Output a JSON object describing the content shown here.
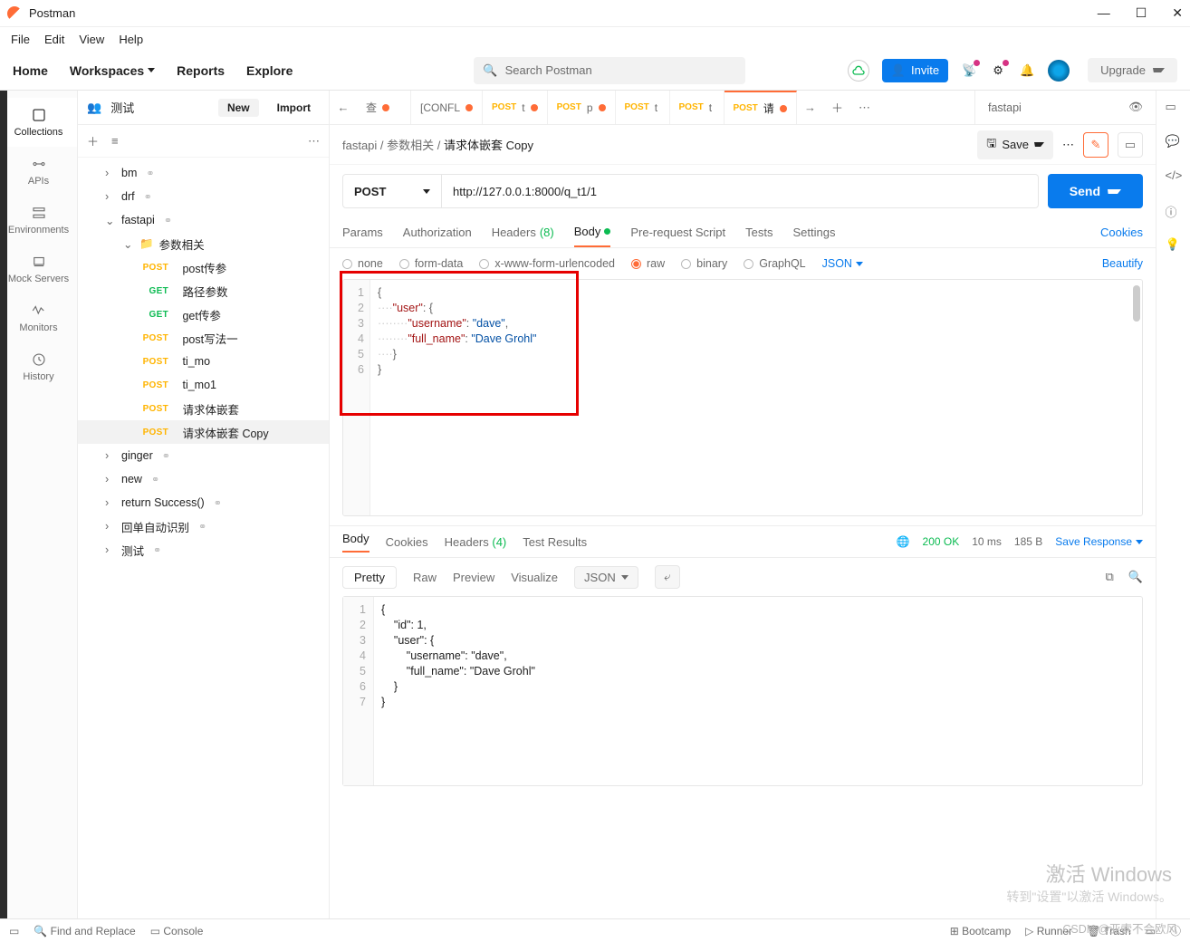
{
  "app": {
    "title": "Postman"
  },
  "menu": [
    "File",
    "Edit",
    "View",
    "Help"
  ],
  "header": {
    "nav": {
      "home": "Home",
      "workspaces": "Workspaces",
      "reports": "Reports",
      "explore": "Explore"
    },
    "search_placeholder": "Search Postman",
    "invite": "Invite",
    "upgrade": "Upgrade"
  },
  "rail": [
    {
      "label": "Collections",
      "icon": "collections-icon"
    },
    {
      "label": "APIs",
      "icon": "apis-icon"
    },
    {
      "label": "Environments",
      "icon": "environments-icon"
    },
    {
      "label": "Mock Servers",
      "icon": "mock-icon"
    },
    {
      "label": "Monitors",
      "icon": "monitors-icon"
    },
    {
      "label": "History",
      "icon": "history-icon"
    }
  ],
  "workspace": {
    "name": "测试",
    "new": "New",
    "import": "Import"
  },
  "tree": {
    "collections": [
      {
        "name": "bm",
        "shared": true
      },
      {
        "name": "drf",
        "shared": true
      },
      {
        "name": "fastapi",
        "shared": true,
        "expanded": true,
        "folders": [
          {
            "name": "参数相关",
            "expanded": true,
            "requests": [
              {
                "method": "POST",
                "name": "post传参"
              },
              {
                "method": "GET",
                "name": "路径参数"
              },
              {
                "method": "GET",
                "name": "get传参"
              },
              {
                "method": "POST",
                "name": "post写法一"
              },
              {
                "method": "POST",
                "name": "ti_mo"
              },
              {
                "method": "POST",
                "name": "ti_mo1"
              },
              {
                "method": "POST",
                "name": "请求体嵌套"
              },
              {
                "method": "POST",
                "name": "请求体嵌套 Copy",
                "selected": true
              }
            ]
          }
        ]
      },
      {
        "name": "ginger",
        "shared": true
      },
      {
        "name": "new",
        "shared": true
      },
      {
        "name": "return Success()",
        "shared": true
      },
      {
        "name": "回单自动识别",
        "shared": true
      },
      {
        "name": "测试",
        "shared": true
      }
    ]
  },
  "tabs": {
    "open": [
      {
        "label": "查",
        "dirty": true
      },
      {
        "label": "[CONFL",
        "dirty": true
      },
      {
        "method": "POST",
        "label": "t",
        "dirty": true
      },
      {
        "method": "POST",
        "label": "p",
        "dirty": true
      },
      {
        "method": "POST",
        "label": "t"
      },
      {
        "method": "POST",
        "label": "t"
      },
      {
        "method": "POST",
        "label": "请",
        "dirty": true,
        "active": true
      }
    ],
    "env": "fastapi"
  },
  "breadcrumb": [
    "fastapi",
    "参数相关",
    "请求体嵌套 Copy"
  ],
  "actions": {
    "save": "Save"
  },
  "request": {
    "method": "POST",
    "url": "http://127.0.0.1:8000/q_t1/1",
    "send": "Send",
    "tabs": [
      {
        "label": "Params"
      },
      {
        "label": "Authorization"
      },
      {
        "label": "Headers",
        "count": "(8)"
      },
      {
        "label": "Body",
        "active": true,
        "dot": true
      },
      {
        "label": "Pre-request Script"
      },
      {
        "label": "Tests"
      },
      {
        "label": "Settings"
      }
    ],
    "cookies": "Cookies",
    "body": {
      "types": [
        {
          "label": "none"
        },
        {
          "label": "form-data"
        },
        {
          "label": "x-www-form-urlencoded"
        },
        {
          "label": "raw",
          "on": true
        },
        {
          "label": "binary"
        },
        {
          "label": "GraphQL"
        }
      ],
      "format": "JSON",
      "beautify": "Beautify",
      "lines": [
        "1",
        "2",
        "3",
        "4",
        "5",
        "6"
      ],
      "content": {
        "user": {
          "username": "dave",
          "full_name": "Dave Grohl"
        }
      }
    }
  },
  "response": {
    "tabs": [
      {
        "label": "Body",
        "active": true
      },
      {
        "label": "Cookies"
      },
      {
        "label": "Headers",
        "count": "(4)"
      },
      {
        "label": "Test Results"
      }
    ],
    "status": {
      "code": "200 OK",
      "time": "10 ms",
      "size": "185 B",
      "save": "Save Response"
    },
    "views": {
      "pretty": "Pretty",
      "raw": "Raw",
      "preview": "Preview",
      "visualize": "Visualize",
      "format": "JSON"
    },
    "lines": [
      "1",
      "2",
      "3",
      "4",
      "5",
      "6",
      "7"
    ],
    "content": {
      "id": 1,
      "user": {
        "username": "dave",
        "full_name": "Dave Grohl"
      }
    }
  },
  "footer": {
    "find": "Find and Replace",
    "console": "Console",
    "bootcamp": "Bootcamp",
    "runner": "Runner",
    "trash": "Trash"
  },
  "watermark": {
    "line1": "激活 Windows",
    "line2": "转到\"设置\"以激活 Windows。"
  },
  "csdn": "CSDN @亚索不会欧风"
}
